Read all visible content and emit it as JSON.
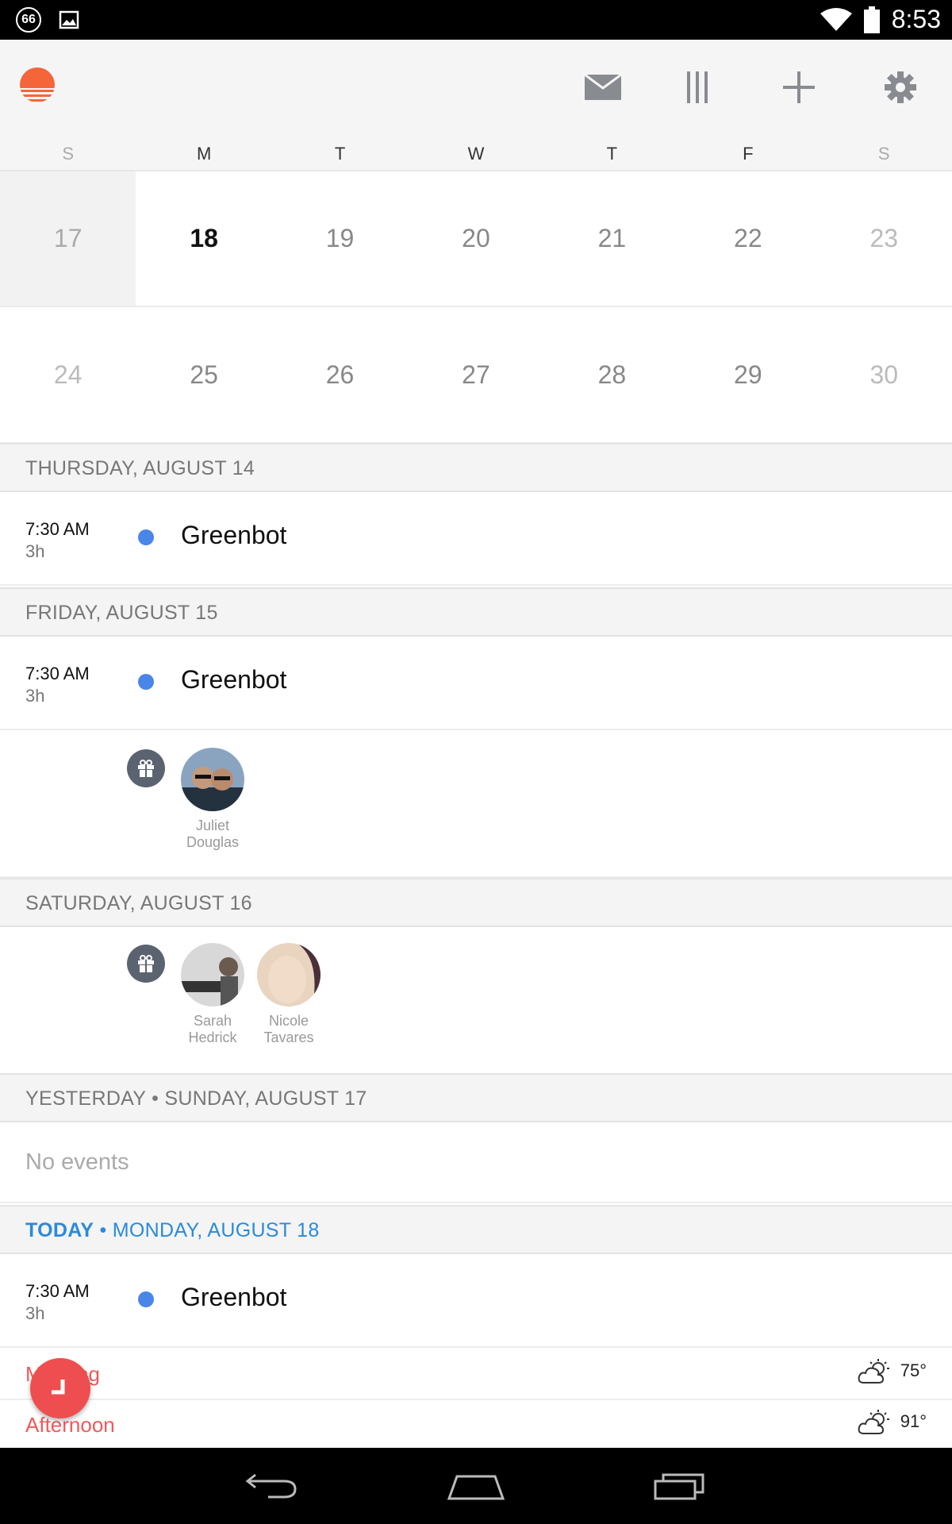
{
  "status_bar": {
    "notification_count": "66",
    "time": "8:53",
    "icons": [
      "notification-count-icon",
      "image-icon",
      "wifi-icon",
      "battery-icon"
    ]
  },
  "header": {
    "logo": "sunrise-logo-icon",
    "actions": [
      "mail-icon",
      "columns-icon",
      "plus-icon",
      "gear-icon"
    ]
  },
  "calendar": {
    "weekdays": [
      "S",
      "M",
      "T",
      "W",
      "T",
      "F",
      "S"
    ],
    "weeks": [
      [
        "17",
        "18",
        "19",
        "20",
        "21",
        "22",
        "23"
      ],
      [
        "24",
        "25",
        "26",
        "27",
        "28",
        "29",
        "30"
      ]
    ]
  },
  "agenda": {
    "thu": {
      "header": "THURSDAY, AUGUST 14",
      "event": {
        "time": "7:30 AM",
        "duration": "3h",
        "title": "Greenbot"
      }
    },
    "fri": {
      "header": "FRIDAY, AUGUST 15",
      "event": {
        "time": "7:30 AM",
        "duration": "3h",
        "title": "Greenbot"
      },
      "birthdays": [
        {
          "first": "Juliet",
          "last": "Douglas"
        }
      ]
    },
    "sat": {
      "header": "SATURDAY, AUGUST 16",
      "birthdays": [
        {
          "first": "Sarah",
          "last": "Hedrick"
        },
        {
          "first": "Nicole",
          "last": "Tavares"
        }
      ]
    },
    "sun": {
      "header": "YESTERDAY • SUNDAY, AUGUST 17",
      "no_events": "No events"
    },
    "mon": {
      "today_word": "TODAY",
      "header_rest": " • MONDAY, AUGUST 18",
      "event": {
        "time": "7:30 AM",
        "duration": "3h",
        "title": "Greenbot"
      },
      "periods": [
        {
          "label": "Morning",
          "temp": "75°"
        },
        {
          "label": "Afternoon",
          "temp": "91°"
        }
      ]
    }
  },
  "colors": {
    "accent_red": "#ef4e50",
    "today_blue": "#2b8ad9",
    "event_dot": "#4a86e8"
  }
}
